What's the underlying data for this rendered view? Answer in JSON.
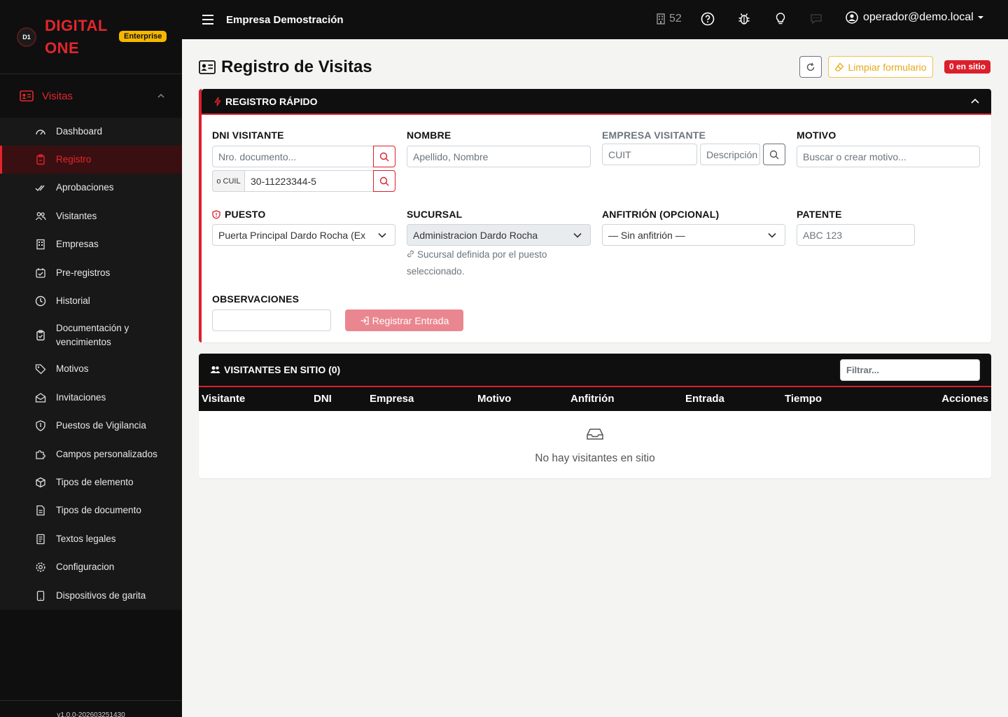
{
  "brand": {
    "logo_text": "D1",
    "name_line1": "DIGITAL",
    "name_line2": "ONE",
    "edition": "Enterprise"
  },
  "sidebar": {
    "group_label": "Visitas",
    "items": [
      {
        "label": "Dashboard",
        "icon": "gauge-icon"
      },
      {
        "label": "Registro",
        "icon": "clipboard-icon",
        "active": true
      },
      {
        "label": "Aprobaciones",
        "icon": "double-check-icon"
      },
      {
        "label": "Visitantes",
        "icon": "people-icon"
      },
      {
        "label": "Empresas",
        "icon": "building-icon"
      },
      {
        "label": "Pre-registros",
        "icon": "calendar-check-icon"
      },
      {
        "label": "Historial",
        "icon": "clock-icon"
      },
      {
        "label": "Documentación y vencimientos",
        "icon": "clipboard-check-icon"
      },
      {
        "label": "Motivos",
        "icon": "tag-icon"
      },
      {
        "label": "Invitaciones",
        "icon": "envelope-open-icon"
      },
      {
        "label": "Puestos de Vigilancia",
        "icon": "shield-icon"
      },
      {
        "label": "Campos personalizados",
        "icon": "puzzle-icon"
      },
      {
        "label": "Tipos de elemento",
        "icon": "box-icon"
      },
      {
        "label": "Tipos de documento",
        "icon": "file-icon"
      },
      {
        "label": "Textos legales",
        "icon": "file-text-icon"
      },
      {
        "label": "Configuracion",
        "icon": "gear-icon"
      },
      {
        "label": "Dispositivos de garita",
        "icon": "tablet-icon"
      }
    ],
    "version": "v1.0.0-202603251430"
  },
  "topbar": {
    "company": "Empresa Demostración",
    "count": "52",
    "user": "operador@demo.local"
  },
  "page": {
    "title": "Registro de Visitas",
    "clear_label": "Limpiar formulario",
    "onsite_badge": "0 en sitio"
  },
  "quick": {
    "title": "REGISTRO RÁPIDO",
    "dni_label": "DNI VISITANTE",
    "dni_placeholder": "Nro. documento...",
    "cuil_prefix": "o CUIL",
    "cuil_value": "30-11223344-5",
    "nombre_label": "NOMBRE",
    "nombre_placeholder": "Apellido, Nombre",
    "empresa_label": "EMPRESA VISITANTE",
    "cuit_placeholder": "CUIT",
    "desc_placeholder": "Descripción",
    "motivo_label": "MOTIVO",
    "motivo_placeholder": "Buscar o crear motivo...",
    "puesto_label": "PUESTO",
    "puesto_value": "Puerta Principal Dardo Rocha (Exterior)",
    "sucursal_label": "SUCURSAL",
    "sucursal_value": "Administracion Dardo Rocha",
    "sucursal_help": "Sucursal definida por el puesto seleccionado.",
    "anfitrion_label": "ANFITRIÓN (OPCIONAL)",
    "anfitrion_value": "— Sin anfitrión —",
    "patente_label": "PATENTE",
    "patente_placeholder": "ABC 123",
    "obs_label": "OBSERVACIONES",
    "submit_label": "Registrar Entrada"
  },
  "onsite": {
    "title": "VISITANTES EN SITIO (0)",
    "filter_placeholder": "Filtrar...",
    "columns": [
      "Visitante",
      "DNI",
      "Empresa",
      "Motivo",
      "Anfitrión",
      "Entrada",
      "Tiempo",
      "Acciones"
    ],
    "empty_text": "No hay visitantes en sitio"
  },
  "colors": {
    "accent": "#dc1f2a",
    "brand_red": "#e3262c",
    "dark": "#0f0f0f",
    "warning": "#f5b700"
  }
}
